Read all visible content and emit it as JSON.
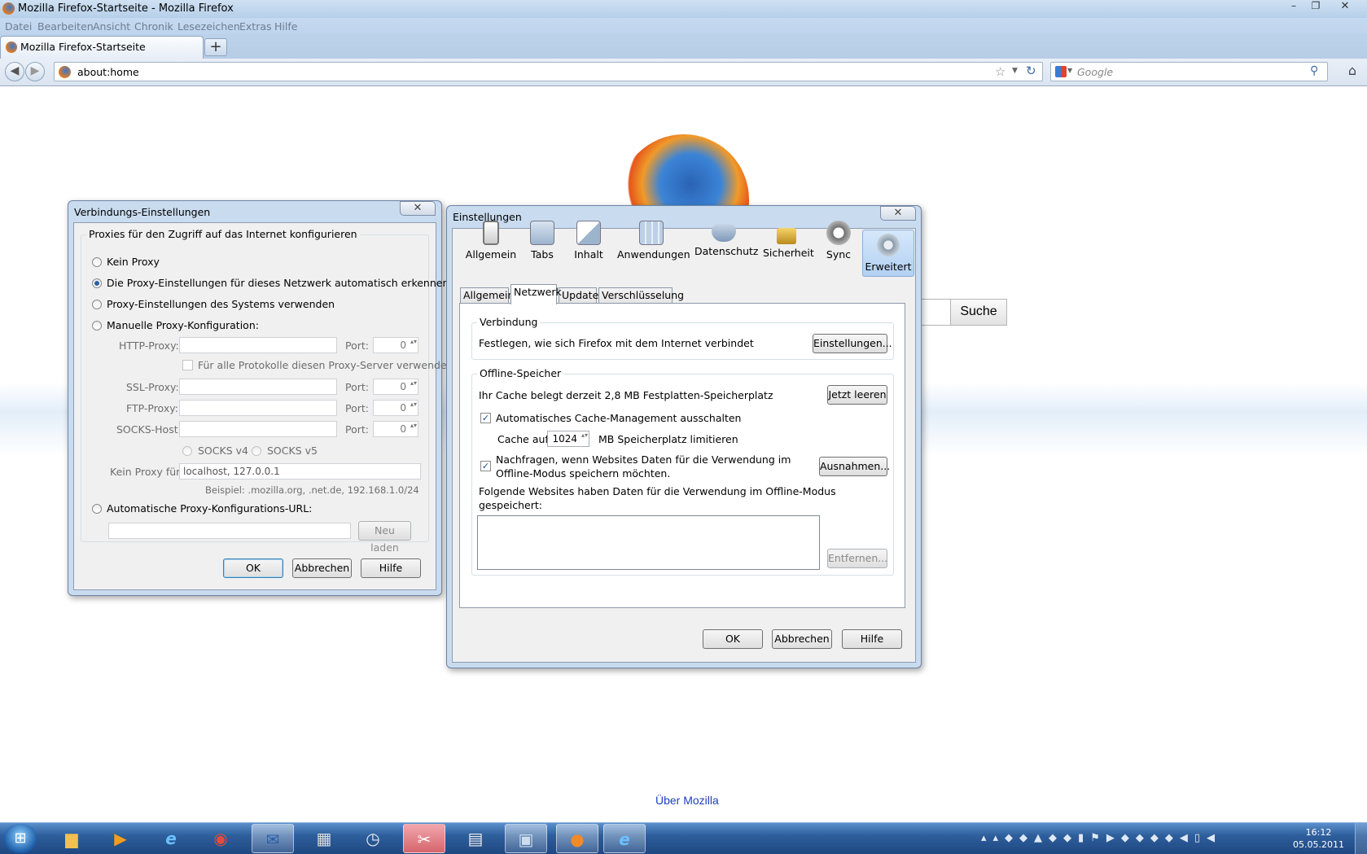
{
  "window": {
    "title": "Mozilla Firefox-Startseite - Mozilla Firefox"
  },
  "menu": [
    "Datei",
    "Bearbeiten",
    "Ansicht",
    "Chronik",
    "Lesezeichen",
    "Extras",
    "Hilfe"
  ],
  "tab": {
    "label": "Mozilla Firefox-Startseite",
    "new_tab": "+"
  },
  "urlbar": {
    "value": "about:home"
  },
  "searchbar": {
    "placeholder": "Google"
  },
  "page": {
    "search_button": "Suche",
    "about_link": "Über Mozilla"
  },
  "conn_dialog": {
    "title": "Verbindungs-Einstellungen",
    "group_title": "Proxies für den Zugriff auf das Internet konfigurieren",
    "options": [
      "Kein Proxy",
      "Die Proxy-Einstellungen für dieses Netzwerk automatisch erkennen",
      "Proxy-Einstellungen des Systems verwenden",
      "Manuelle Proxy-Konfiguration:"
    ],
    "selected_option": 1,
    "http_label": "HTTP-Proxy:",
    "port_label": "Port:",
    "http_port": "0",
    "same_proxy_label": "Für alle Protokolle diesen Proxy-Server verwenden",
    "ssl_label": "SSL-Proxy:",
    "ssl_port": "0",
    "ftp_label": "FTP-Proxy:",
    "ftp_port": "0",
    "socks_label": "SOCKS-Host:",
    "socks_port": "0",
    "socks_v4": "SOCKS v4",
    "socks_v5": "SOCKS v5",
    "noproxy_label": "Kein Proxy für:",
    "noproxy_value": "localhost, 127.0.0.1",
    "example": "Beispiel: .mozilla.org, .net.de, 192.168.1.0/24",
    "auto_url_label": "Automatische Proxy-Konfigurations-URL:",
    "reload": "Neu laden",
    "ok": "OK",
    "cancel": "Abbrechen",
    "help": "Hilfe"
  },
  "prefs_dialog": {
    "title": "Einstellungen",
    "toolbar": [
      {
        "label": "Allgemein",
        "icon": "general-icon"
      },
      {
        "label": "Tabs",
        "icon": "tabs-icon"
      },
      {
        "label": "Inhalt",
        "icon": "content-icon"
      },
      {
        "label": "Anwendungen",
        "icon": "applications-icon"
      },
      {
        "label": "Datenschutz",
        "icon": "privacy-mask-icon"
      },
      {
        "label": "Sicherheit",
        "icon": "padlock-icon"
      },
      {
        "label": "Sync",
        "icon": "sync-icon"
      },
      {
        "label": "Erweitert",
        "icon": "gear-icon"
      }
    ],
    "selected_pane": "Erweitert",
    "subtabs": [
      "Allgemein",
      "Netzwerk",
      "Update",
      "Verschlüsselung"
    ],
    "selected_subtab": "Netzwerk",
    "connection": {
      "title": "Verbindung",
      "text": "Festlegen, wie sich Firefox mit dem Internet verbindet",
      "button": "Einstellungen..."
    },
    "offline": {
      "title": "Offline-Speicher",
      "usage_text": "Ihr Cache belegt derzeit 2,8 MB Festplatten-Speicherplatz",
      "clear_button": "Jetzt leeren",
      "override_cache": "Automatisches Cache-Management ausschalten",
      "cache_limit_label": "Cache auf",
      "cache_limit_value": "1024",
      "cache_limit_unit": "MB Speicherplatz limitieren",
      "ask_line1": "Nachfragen, wenn Websites Daten für die Verwendung im",
      "ask_line2": "Offline-Modus speichern möchten.",
      "exceptions_button": "Ausnahmen...",
      "list_line1": "Folgende Websites haben Daten für die Verwendung im Offline-Modus",
      "list_line2": "gespeichert:",
      "remove_button": "Entfernen..."
    },
    "ok": "OK",
    "cancel": "Abbrechen",
    "help": "Hilfe"
  },
  "taskbar": {
    "time": "16:12",
    "date": "05.05.2011"
  }
}
